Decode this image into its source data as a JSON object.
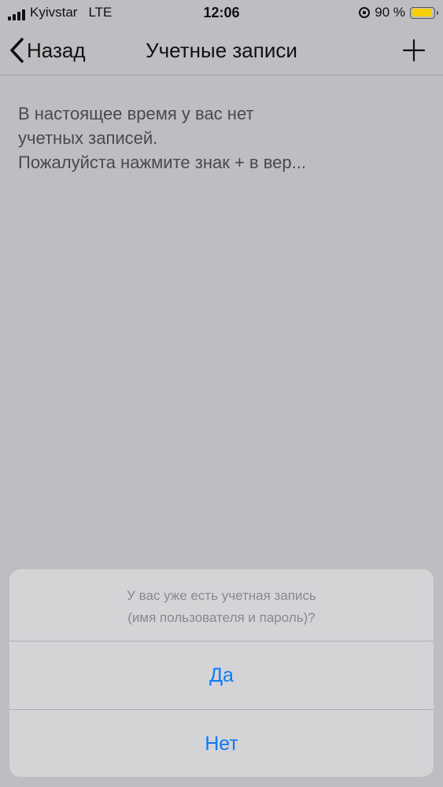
{
  "status_bar": {
    "carrier": "Kyivstar",
    "network": "LTE",
    "time": "12:06",
    "battery_percent": "90 %",
    "battery_level": 0.9,
    "battery_color": "#f8d000"
  },
  "nav": {
    "back_label": "Назад",
    "title": "Учетные записи",
    "add_icon": "plus-icon"
  },
  "empty_state": {
    "line1": "В настоящее время у вас нет",
    "line2": "учетных записей.",
    "line3": "Пожалуйста нажмите знак + в вер..."
  },
  "action_sheet": {
    "message_line1": "У вас уже есть учетная запись",
    "message_line2": "(имя пользователя и пароль)?",
    "yes_label": "Да",
    "no_label": "Нет",
    "accent_color": "#0a7aff"
  }
}
